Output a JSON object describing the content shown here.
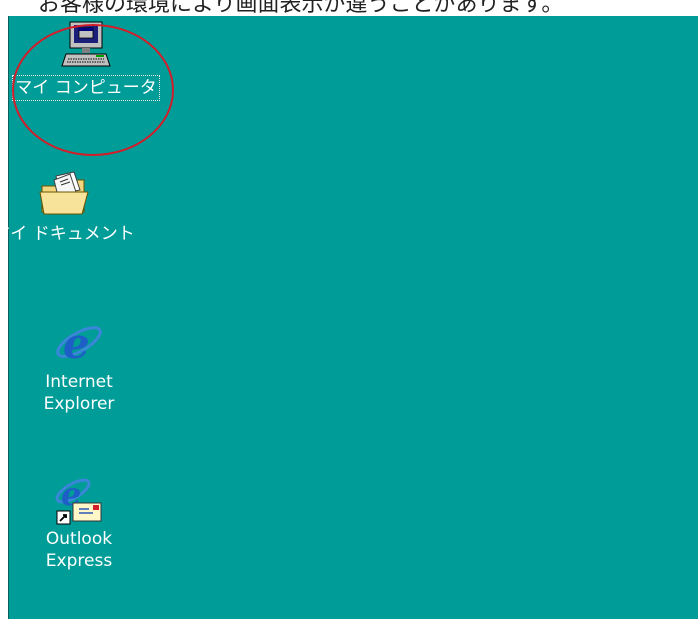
{
  "caption": {
    "text": "お客様の環境により画面表示が違うことがあります。"
  },
  "desktop": {
    "background": "#009c98",
    "icons": [
      {
        "label": "マイ コンピュータ",
        "icon": "my-computer-icon",
        "selected": true
      },
      {
        "label": "マイ ドキュメント",
        "icon": "my-documents-folder-icon",
        "selected": false
      },
      {
        "label": "Internet\nExplorer",
        "icon": "internet-explorer-icon",
        "selected": false
      },
      {
        "label": "Outlook\nExpress",
        "icon": "outlook-express-icon",
        "selected": false
      }
    ]
  },
  "annotation": {
    "highlight_color": "#d21e2a"
  }
}
